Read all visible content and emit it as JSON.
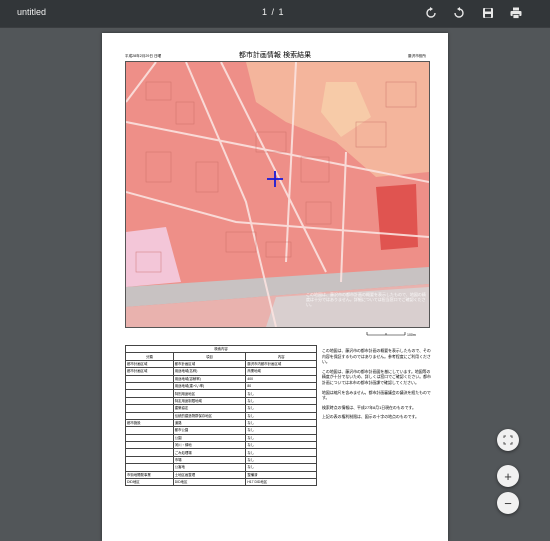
{
  "toolbar": {
    "title": "untitled",
    "page_counter": "1 / 1",
    "icons": [
      "rotate-clockwise-icon",
      "rotate-counterclockwise-icon",
      "download-icon",
      "print-icon"
    ]
  },
  "document": {
    "header": {
      "date": "平成28年2月29日 日曜",
      "title": "都市計画情報 検索結果",
      "office": "藤沢市役所"
    },
    "map_note": "この地図は、藤沢市の都市計画の概要を表示したもので、地図の精度は十分ではありません。詳細については担当窓口でご確認ください。",
    "table": {
      "caption": "検索内容",
      "columns": [
        "分類",
        "項目",
        "内容"
      ],
      "rows": [
        [
          "都市計画区域",
          "都市計画区域",
          "藤沢市内都市計画区域"
        ],
        [
          "都市計画区域",
          "用途地域(名称)",
          "商業地域"
        ],
        [
          "",
          "用途地域(容積率)",
          "400"
        ],
        [
          "",
          "用途地域(建ぺい率)",
          "80"
        ],
        [
          "",
          "特別用途地区",
          "なし"
        ],
        [
          "",
          "特定用途制限地域",
          "なし"
        ],
        [
          "",
          "建築協定",
          "なし"
        ],
        [
          "",
          "伝統的建造物群保存地区",
          "なし"
        ],
        [
          "都市施設",
          "道路",
          "なし"
        ],
        [
          "",
          "都市公園",
          "なし"
        ],
        [
          "",
          "公園",
          "なし"
        ],
        [
          "",
          "河川・緑地",
          "なし"
        ],
        [
          "",
          "ごみ処理場",
          "なし"
        ],
        [
          "",
          "市場",
          "なし"
        ],
        [
          "",
          "公害地",
          "なし"
        ],
        [
          "市街地開発事業",
          "土地区画整理",
          "整備済"
        ],
        [
          "DID地区",
          "DID地区",
          "H17 DID地区"
        ]
      ]
    },
    "notes": [
      "この地図は、藤沢市の都市計画の概要を表示したもので、その内容を保証するものではありません。参考程度にご利用ください。",
      "この地図は、藤沢市の都市計画図を基にしています。地図等の精度が十分でないため、詳しくは窓口でご確認ください。都市計画については本市の都市計画課で確認してください。",
      "地図は縮尺を含みません。都市計画審議会の議決を経たものです。",
      "検索時点の情報は、平成27年8月1日現在のものです。",
      "上記の表の権利制限は、図示の十字の地点のものです。"
    ],
    "scale_label": "100m"
  },
  "controls": {
    "fit_label": "fit",
    "zoom_in": "+",
    "zoom_out": "−"
  }
}
